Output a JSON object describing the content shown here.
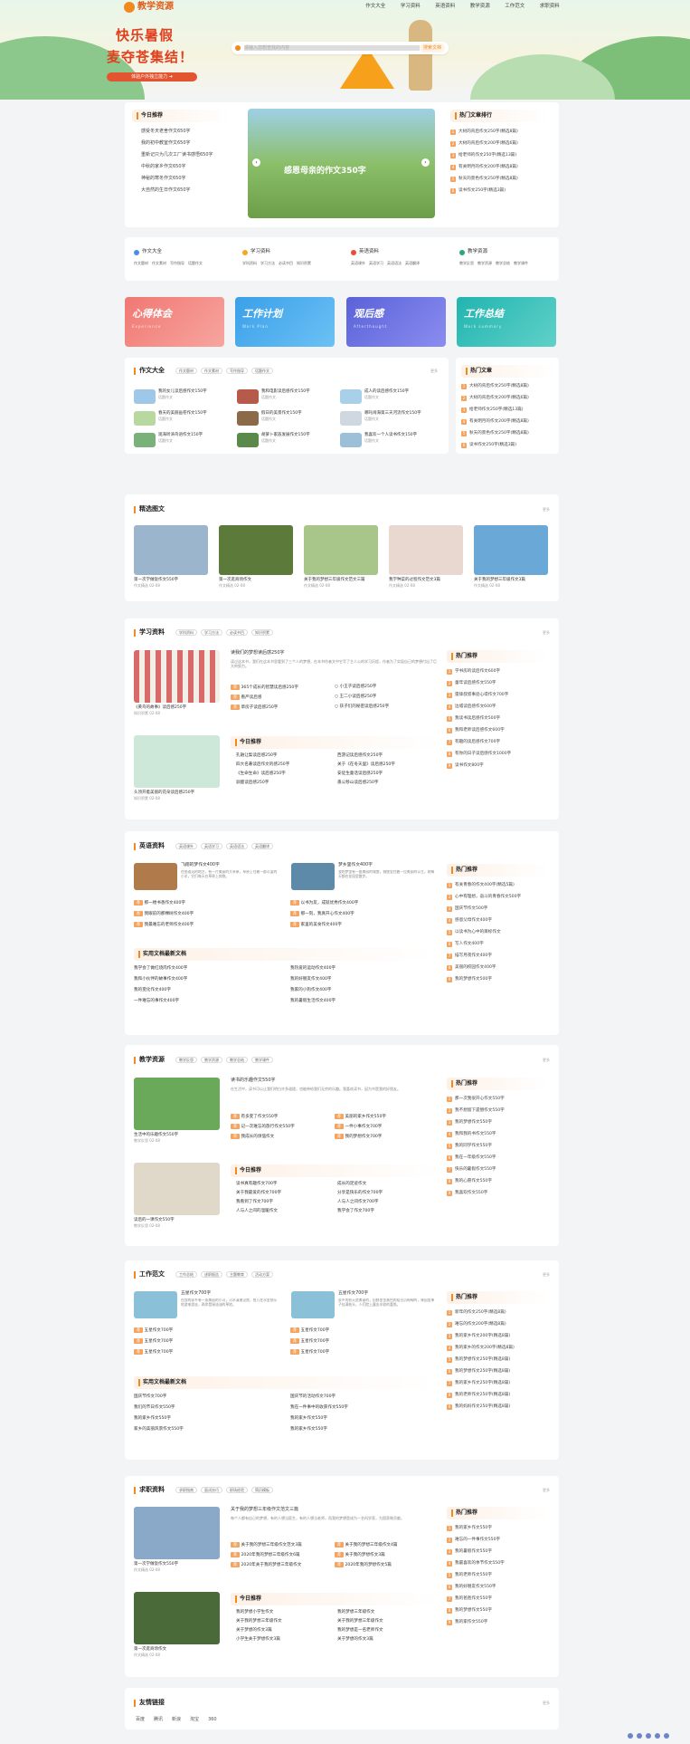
{
  "brand": {
    "name": "教学资源"
  },
  "nav": [
    "作文大全",
    "学习资料",
    "英语资料",
    "教学资源",
    "工作范文",
    "求职资料"
  ],
  "hero": {
    "line1": "快乐暑假",
    "line2": "麦夺苍集结！",
    "pill": "体验户外独立能力 ➜",
    "search_placeholder": "请输入您想查找的内容",
    "search_button": "搜索文档"
  },
  "today": {
    "title": "今日推荐",
    "items": [
      "感受冬天老舍作文650字",
      "我的初中教室作文650字",
      "重新记只为几次工厂读书感悟650字",
      "中秋的家乡作文650字",
      "神秘的寒冬作文650字",
      "大自然的生日作文650字"
    ]
  },
  "slider": {
    "caption": "感恩母亲的作文350字"
  },
  "hot": {
    "title": "热门文章排行",
    "items": [
      "大树的背后作文250字(精选8篇)",
      "大树的背后作文200字(精选6篇)",
      "给老师的作文250字(精选13篇)",
      "有关明月的作文200字(精选8篇)",
      "秋天的景色作文250字(精选8篇)",
      "读书作文250字(精选3篇)"
    ]
  },
  "cats": [
    {
      "name": "作文大全",
      "subs": [
        "作文题材",
        "作文素材",
        "写作指导",
        "话题作文"
      ]
    },
    {
      "name": "学习资料",
      "subs": [
        "学科资料",
        "学习方法",
        "必读书目",
        "知识积累"
      ]
    },
    {
      "name": "英语资料",
      "subs": [
        "英语课外",
        "英语学习",
        "英语语法",
        "英语翻译"
      ]
    },
    {
      "name": "教学资源",
      "subs": [
        "教学反思",
        "教学资源",
        "教学总结",
        "教学课件"
      ]
    }
  ],
  "promos": [
    {
      "a": "心得体会",
      "b": "Experience"
    },
    {
      "a": "工作计划",
      "b": "Work Plan"
    },
    {
      "a": "观后感",
      "b": "Afterthought"
    },
    {
      "a": "工作总结",
      "b": "Work summary"
    }
  ],
  "essay": {
    "title": "作文大全",
    "tags": [
      "作文题材",
      "作文素材",
      "写作指导",
      "话题作文"
    ],
    "more": "更多",
    "items": [
      {
        "t": "我的女儿读后感作文150字",
        "s": "话题作文"
      },
      {
        "t": "我和电影读后感作文150字",
        "s": "话题作文"
      },
      {
        "t": "成人的读后感作文150字",
        "s": "话题作文"
      },
      {
        "t": "春天的美丽画卷作文150字",
        "s": "话题作文"
      },
      {
        "t": "假日的美景作文150字",
        "s": "话题作文"
      },
      {
        "t": "哪吒闹海第三天河流作文150字",
        "s": "话题作文"
      },
      {
        "t": "观海听涛鸟语作文150字",
        "s": "话题作文"
      },
      {
        "t": "胡萝卜家族发展作文150字",
        "s": "话题作文"
      },
      {
        "t": "我喜欢一个人读书作文150字",
        "s": "话题作文"
      }
    ]
  },
  "hotArt": {
    "title": "热门文章",
    "items": [
      "大树的背后作文250字(精选8篇)",
      "大树的背后作文200字(精选6篇)",
      "给老师作文250字(精选13篇)",
      "有关明月的作文200字(精选8篇)",
      "秋天的景色作文250字(精选8篇)",
      "读书作文250字(精选3篇)"
    ]
  },
  "pics": {
    "title": "精选图文",
    "more": "更多",
    "items": [
      {
        "t": "第一次学做饭作文550字",
        "s": "作文精选 02-08"
      },
      {
        "t": "第一次逛商场作文",
        "s": "作文精选 02-08"
      },
      {
        "t": "关于我的梦想三年级作文范文三篇",
        "s": "作文精选 02-08"
      },
      {
        "t": "我学种菜的过程作文范文3篇",
        "s": "作文精选 02-08"
      },
      {
        "t": "关于我的梦想三年级作文3篇",
        "s": "作文精选 02-08"
      }
    ]
  },
  "study": {
    "title": "学习资料",
    "tags": [
      "学科资料",
      "学习方法",
      "必读书目",
      "知识积累"
    ],
    "more": "更多",
    "lead": "读我们的梦想读后感250字",
    "lead_desc": "读过这本书，我们在这本书里看到了三个人的梦想，在本书作者文中它写了主人公的学习历程，作者为了实现自己的梦想付出了巨大的努力。",
    "card1": {
      "t": "《黄鸟的故事》读后感250字",
      "s": "知识积累 02-08"
    },
    "card2": {
      "t": "头顶开着美丽的花朵读后感250字",
      "s": "知识积累 02-08"
    },
    "items": [
      "365个成长的智慧读后感250字",
      "小王子读后感250字",
      "看严读后感",
      "王二小读后感250字",
      "草房子读后感250字",
      "孩子们的秘密读后感250字"
    ],
    "today": [
      "孔融让梨读后感250字",
      "西游记读后感作文250字",
      "四大名著读后作文的感250字",
      "关于《在冬天里》读后感250字",
      "《生命生命》读后感250字",
      "安徒生童话读后感250字",
      "驯鹿读后感250字",
      "愚公移山读后感250字"
    ],
    "rank": [
      "学书房的读后作文600字",
      "童年读后感作文550字",
      "雷锋叔叔事迹心得作文700字",
      "边城读后感作文600字",
      "我读书读后感作文500字",
      "我和老师读后感作文600字",
      "有趣的读后感作文700字",
      "有你的日子读后感作文1000字",
      "读书作文800字"
    ]
  },
  "english": {
    "title": "英语资料",
    "tags": [
      "英语课外",
      "英语学习",
      "英语语法",
      "英语翻译"
    ],
    "more": "更多",
    "a": {
      "t": "飞翔的梦作文400字",
      "d": "在那遥远的地方，有一片美丽的大草原，草原上住着一群可爱的小羊，它们每天在草原上奔跑。"
    },
    "b": {
      "t": "梦乡里作文400字",
      "d": "我的梦里有一座美丽的城堡，城堡里住着一位美丽的公主，她每天都在花园里散步。"
    },
    "rows": [
      "那一缕书香作文400字",
      "以书为友，成就优秀作文400字",
      "我眼前的那棵树作文400字",
      "那一刻，我真开心作文400字",
      "我最难忘的老师作文400字",
      "家里的美食作文400字"
    ],
    "latest": [
      "我学会了做红烧肉作文400字",
      "我热爱的运动作文400字",
      "我和小伙伴的故事作文400字",
      "我的好朋友作文400字",
      "我的变化作文400字",
      "我家的小狗作文400字",
      "一件难忘的事作文400字",
      "我的暑假生活作文400字"
    ],
    "rank": [
      "有关青春的作文400字(精选5篇)",
      "心中有理想，奋斗的青春作文500字",
      "国庆节作文500字",
      "感恩父母作文400字",
      "以读书为心中的目标作文",
      "写人作文400字",
      "描写月夜作文400字",
      "美丽的校园作文400字",
      "我的梦想作文500字"
    ]
  },
  "teach": {
    "title": "教学资源",
    "tags": [
      "教学反思",
      "教学资源",
      "教学总结",
      "教学课件"
    ],
    "more": "更多",
    "lead": "读书的乐趣作文550字",
    "lead_desc": "在生活中，读书可以让我们明白许多道理，也能带给我们无穷的乐趣。我喜欢读书，因为书是我的好朋友。",
    "card1": {
      "t": "生活中的乐趣作文550字",
      "s": "教学反思 02-08"
    },
    "card2": {
      "t": "读后的一课作文550字",
      "s": "教学反思 02-08"
    },
    "items": [
      "有多变了作文550字",
      "美丽的家乡作文550字",
      "记一次难忘的旅行作文550字",
      "一件小事作文700字",
      "我成长的烦恼作文",
      "我的梦想作文700字"
    ],
    "today": [
      "读书真有趣作文700字",
      "成长的足迹作文",
      "关于我最爱的作文700字",
      "分享是快乐的作文700字",
      "我看到了作文700字",
      "人与人之间作文700字",
      "人与人之间的温暖作文",
      "我学会了作文700字"
    ],
    "rank": [
      "那一次我很开心作文550字",
      "我不想留下遗憾作文550字",
      "我的梦想作文550字",
      "我和我的书作文550字",
      "我的同学作文550字",
      "我在一年级作文550字",
      "快乐的暑假作文550字",
      "我的心愿作文550字",
      "我喜欢作文550字"
    ]
  },
  "work": {
    "title": "工作范文",
    "tags": [
      "工作总结",
      "述职报告",
      "主题教育",
      "活动方案"
    ],
    "more": "更多",
    "a": {
      "t": "五星作文700字",
      "d": "在我的家乡有一条美丽的小河，河水清澈见底，鱼儿在水里快乐地游来游去，两岸是绿油油的草地。"
    },
    "b": {
      "t": "五星作文700字",
      "d": "家乡的秋天是美丽的，田野里金黄色的稻谷沉甸甸的，果园里果子挂满枝头，人们脸上露出丰收的喜悦。"
    },
    "rows": [
      "五星作文700字",
      "五星作文700字",
      "五星作文700字",
      "五星作文700字",
      "五星作文700字",
      "五星作文700字"
    ],
    "latest": [
      "国庆节作文700字",
      "国庆节的活动作文700字",
      "我们的节日作文550字",
      "我在一件事中的收获作文550字",
      "我的家乡作文550字",
      "我的家乡作文550字",
      "家乡的美丽风景作文550字",
      "我的家乡作文550字"
    ],
    "rank": [
      "新年的作文250字(精选8篇)",
      "难忘的作文200字(精选8篇)",
      "我的家乡作文200字(精选8篇)",
      "我的家乡的作文200字(精选8篇)",
      "我的梦想作文250字(精选8篇)",
      "我的梦想作文250字(精选8篇)",
      "我的家乡作文250字(精选8篇)",
      "我的老师作文250字(精选8篇)",
      "我的妈妈作文250字(精选8篇)"
    ]
  },
  "job": {
    "title": "求职资料",
    "tags": [
      "求职指南",
      "面试技巧",
      "职场经验",
      "简历模板"
    ],
    "more": "更多",
    "lead": "关于我的梦想三年级作文范文三篇",
    "lead_desc": "每个人都有自己的梦想，有的人想当医生，有的人想当老师，而我的梦想是成为一名科学家，为国家做贡献。",
    "card1": {
      "t": "第一次学做饭作文550字",
      "s": "作文精选 02-08"
    },
    "card2": {
      "t": "第一次逛商场作文",
      "s": "作文精选 02-08"
    },
    "items": [
      "关于我的梦想三年级作文范文3篇",
      "关于我的梦想三年级作文4篇",
      "2020年我的梦想三年级作文6篇",
      "关于我的梦想作文3篇",
      "2020年关于我的梦想三年级作文",
      "2020年我的梦想作文5篇"
    ],
    "today": [
      "我的梦想小学生作文",
      "我的梦想三年级作文",
      "关于我的梦想三年级作文",
      "关于我的梦想三年级作文",
      "关于梦想的作文3篇",
      "我的梦想是一名老师作文",
      "小学生关于梦想作文3篇",
      "关于梦想的作文3篇"
    ],
    "rank": [
      "我的家乡作文550字",
      "难忘的一件事作文550字",
      "我的暑假作文550字",
      "我最喜欢的季节作文550字",
      "我的老师作文550字",
      "我的好朋友作文550字",
      "我的爸爸作文550字",
      "我的梦想作文550字",
      "我的家作文550字"
    ]
  },
  "links": {
    "title": "友情链接",
    "more": "更多",
    "items": [
      "百度",
      "腾讯",
      "新浪",
      "淘宝",
      "360"
    ]
  },
  "colors": {
    "accent": "#f08a1c",
    "rank": "#f4a460"
  }
}
